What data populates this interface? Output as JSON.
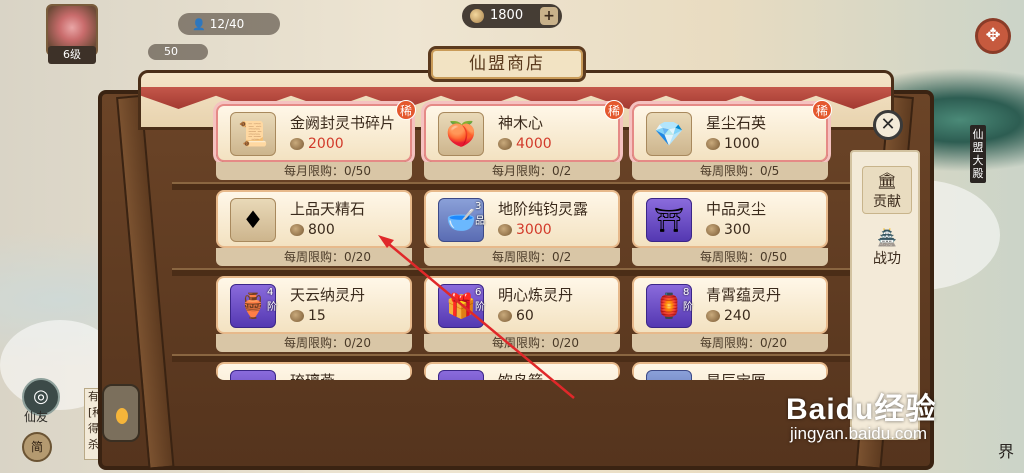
{
  "topbar": {
    "member_count": "12/40",
    "level": "6级",
    "sub_value": "50",
    "currency_amount": "1800",
    "currency_plus": "+"
  },
  "shop": {
    "title": "仙盟商店",
    "rare_label": "稀"
  },
  "items": [
    {
      "name": "金阙封灵书碎片",
      "price": "2000",
      "price_red": true,
      "limit": "每月限购：0/50",
      "rare": true,
      "tier": "",
      "icon": "book-fragment-icon",
      "icon_glyph": "📜",
      "box": ""
    },
    {
      "name": "神木心",
      "price": "4000",
      "price_red": true,
      "limit": "每月限购：0/2",
      "rare": true,
      "tier": "",
      "icon": "wood-heart-icon",
      "icon_glyph": "🍑",
      "box": ""
    },
    {
      "name": "星尘石英",
      "price": "1000",
      "price_red": false,
      "limit": "每周限购：0/5",
      "rare": true,
      "tier": "",
      "icon": "crystal-icon",
      "icon_glyph": "💎",
      "box": ""
    },
    {
      "name": "上品天精石",
      "price": "800",
      "price_red": false,
      "limit": "每周限购：0/20",
      "rare": false,
      "tier": "",
      "icon": "red-crystal-icon",
      "icon_glyph": "♦",
      "box": ""
    },
    {
      "name": "地阶纯钧灵露",
      "price": "3000",
      "price_red": true,
      "limit": "每周限购：0/2",
      "rare": false,
      "tier": "3品",
      "icon": "dew-bowl-icon",
      "icon_glyph": "🥣",
      "box": "blue"
    },
    {
      "name": "中品灵尘",
      "price": "300",
      "price_red": false,
      "limit": "每周限购：0/50",
      "rare": false,
      "tier": "",
      "icon": "spirit-dust-icon",
      "icon_glyph": "⛩",
      "box": "purple"
    },
    {
      "name": "天云纳灵丹",
      "price": "15",
      "price_red": false,
      "limit": "每周限购：0/20",
      "rare": false,
      "tier": "4阶",
      "icon": "gourd-pill-icon",
      "icon_glyph": "🏺",
      "box": "purple"
    },
    {
      "name": "明心炼灵丹",
      "price": "60",
      "price_red": false,
      "limit": "每周限购：0/20",
      "rare": false,
      "tier": "6阶",
      "icon": "pill-box-icon",
      "icon_glyph": "🎁",
      "box": "purple"
    },
    {
      "name": "青霄蕴灵丹",
      "price": "240",
      "price_red": false,
      "limit": "每周限购：0/20",
      "rare": false,
      "tier": "8阶",
      "icon": "elixir-icon",
      "icon_glyph": "🏮",
      "box": "purple"
    },
    {
      "name": "琉璃燕",
      "price": "",
      "price_red": false,
      "limit": "",
      "rare": false,
      "tier": "",
      "icon": "partial-item-icon",
      "icon_glyph": "",
      "box": "purple"
    },
    {
      "name": "饮鸟箭",
      "price": "",
      "price_red": false,
      "limit": "",
      "rare": false,
      "tier": "",
      "icon": "partial-item-icon",
      "icon_glyph": "",
      "box": "purple"
    },
    {
      "name": "星辰宝匣",
      "price": "",
      "price_red": false,
      "limit": "",
      "rare": false,
      "tier": "",
      "icon": "partial-item-icon",
      "icon_glyph": "",
      "box": "blue"
    }
  ],
  "tabs": [
    {
      "label": "贡献",
      "glyph": "🏛",
      "active": true
    },
    {
      "label": "战功",
      "glyph": "🏯",
      "active": false
    }
  ],
  "side": {
    "xianyou_label": "仙友",
    "jian_label": "简",
    "vertical_label": "仙盟大殿",
    "chat_lines": [
      "有",
      "[种",
      "得",
      "杀"
    ],
    "world_label": "界"
  },
  "watermark": {
    "big": "Baidu经验",
    "small": "jingyan.baidu.com"
  },
  "colors": {
    "price_red": "#d23a2a",
    "rare_badge": "#e4582e",
    "arrow": "#e0282a"
  }
}
